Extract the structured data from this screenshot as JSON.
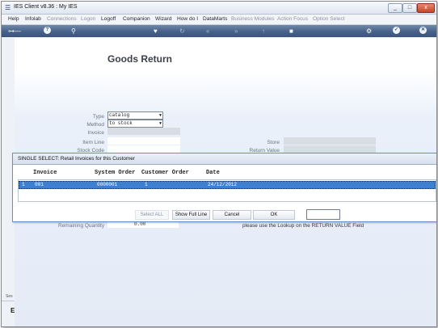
{
  "window": {
    "title": "IES Client v8.36 : My IES",
    "minimize": "_",
    "maximize": "□",
    "close": "x"
  },
  "menu": {
    "items": [
      {
        "label": "Help",
        "enabled": true
      },
      {
        "label": "Infolab",
        "enabled": true
      },
      {
        "label": "Connections",
        "enabled": false
      },
      {
        "label": "Logon",
        "enabled": false
      },
      {
        "label": "Logoff",
        "enabled": true
      },
      {
        "label": "Companion",
        "enabled": true
      },
      {
        "label": "Wizard",
        "enabled": true
      },
      {
        "label": "How do I",
        "enabled": true
      },
      {
        "label": "DataMarts",
        "enabled": true
      },
      {
        "label": "Business Modules",
        "enabled": false
      },
      {
        "label": "Action Focus",
        "enabled": false
      },
      {
        "label": "Option Select",
        "enabled": false
      }
    ]
  },
  "toolbar": {
    "icons": [
      "key-icon",
      "help-icon",
      "search-icon",
      "heart-icon",
      "refresh-icon",
      "rewind-icon",
      "forward-icon",
      "up-icon",
      "stop-icon",
      "gear-icon",
      "ok-icon",
      "close-icon"
    ]
  },
  "form": {
    "title": "Goods Return",
    "type_label": "Type",
    "type_value": "catalog",
    "method_label": "Method",
    "method_value": "to stock",
    "invoice_label": "Invoice",
    "item_line_label": "Item Line",
    "stock_code_label": "Stock Code",
    "store_label": "Store",
    "return_value_label": "Return Value",
    "remaining_quantity_label": "Remaining Quantity",
    "remaining_quantity_value": "0.00",
    "hint": "please use the Lookup on the RETURN VALUE Field"
  },
  "dialog": {
    "title": "SINGLE SELECT: Retail Invoices for this Customer",
    "columns": [
      "Invoice",
      "System Order",
      "Customer Order",
      "Date"
    ],
    "rows": [
      {
        "index": "1",
        "invoice": "001",
        "system_order": "0000001",
        "customer_order": "1",
        "date": "24/12/2012"
      }
    ],
    "buttons": {
      "select_all": "Select ALL",
      "show_full_line": "Show Full Line",
      "cancel": "Cancel",
      "ok": "OK"
    }
  },
  "leftstrip": {
    "top_text": "Ses",
    "bottom_text": "E"
  },
  "colors": {
    "toolbar": "#47618a",
    "selected_row": "#3d7fd0"
  }
}
